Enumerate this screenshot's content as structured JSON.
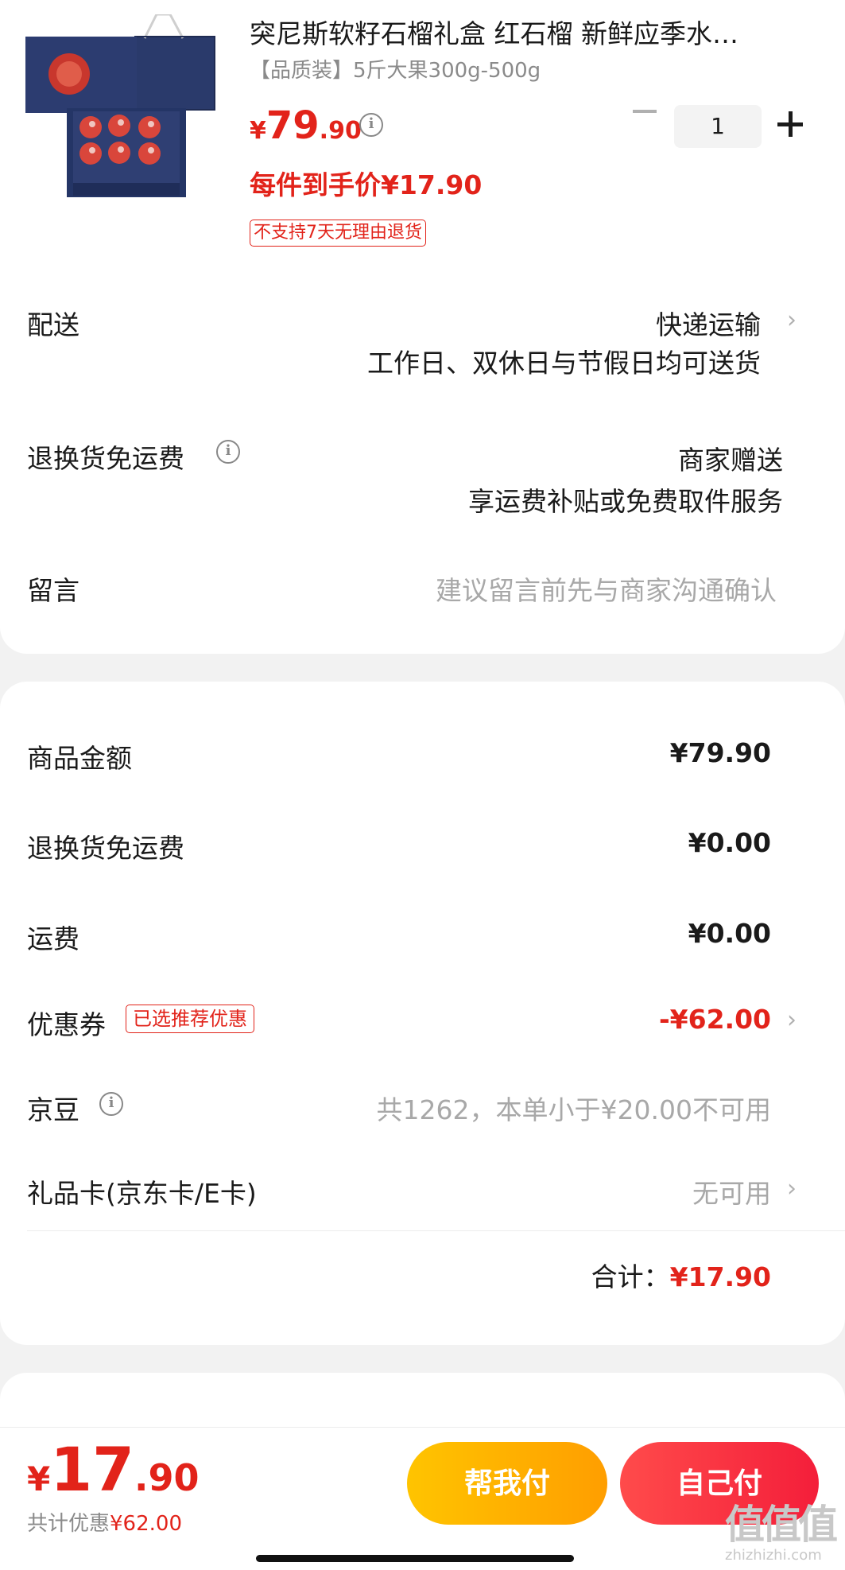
{
  "product": {
    "title": "突尼斯软籽石榴礼盒 红石榴 新鲜应季水…",
    "spec": "【品质装】5斤大果300g-500g",
    "price_yen": "¥",
    "price_int": "79",
    "price_dec": ".90",
    "unit_price": "每件到手价¥17.90",
    "return_tag": "不支持7天无理由退货",
    "quantity": "1",
    "info_glyph": "i"
  },
  "shipping": {
    "label": "配送",
    "method": "快递运输",
    "note": "工作日、双休日与节假日均可送货",
    "chevron": "›"
  },
  "return_shipping": {
    "label": "退换货免运费",
    "value": "商家赠送",
    "note": "享运费补贴或免费取件服务"
  },
  "message": {
    "label": "留言",
    "placeholder": "建议留言前先与商家沟通确认"
  },
  "summary": {
    "goods_label": "商品金额",
    "goods_amount": "¥79.90",
    "return_fee_label": "退换货免运费",
    "return_fee_amount": "¥0.00",
    "freight_label": "运费",
    "freight_amount": "¥0.00",
    "coupon_label": "优惠券",
    "coupon_tag": "已选推荐优惠",
    "coupon_amount": "-¥62.00",
    "jingdou_label": "京豆",
    "jingdou_note": "共1262，本单小于¥20.00不可用",
    "giftcard_label": "礼品卡(京东卡/E卡)",
    "giftcard_value": "无可用",
    "total_label": "合计：",
    "total_amount": "¥17.90"
  },
  "bottom": {
    "yen": "¥",
    "price_int": "17",
    "price_dec": ".90",
    "saving_label": "共计优惠",
    "saving_amount": "¥62.00",
    "help_pay": "帮我付",
    "self_pay": "自己付",
    "watermark": "值值值",
    "watermark_sub": "zhizhizhi.com"
  },
  "colors": {
    "accent_red": "#e2231a",
    "button_yellow": "#ffb300",
    "button_red": "#f53246"
  }
}
